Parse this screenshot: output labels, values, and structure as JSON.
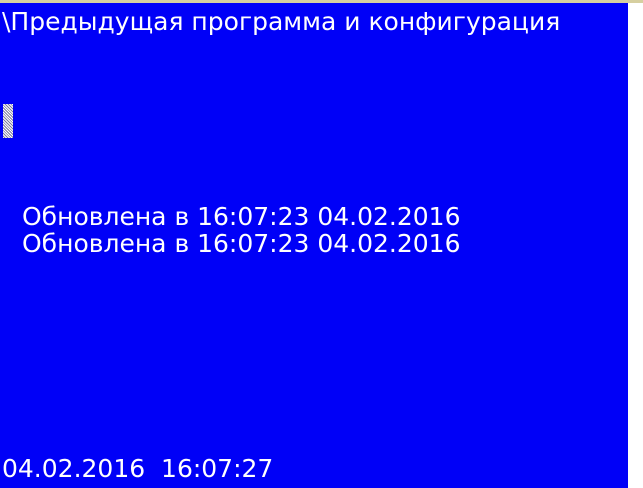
{
  "screen": {
    "title": "\\Предыдущая программа и конфигурация",
    "background_color": "#0000f7",
    "text_color": "#ffffff",
    "status_lines": [
      "Обновлена в 16:07:23 04.02.2016",
      "Обновлена в 16:07:23 04.02.2016"
    ],
    "footer_date": "04.02.2016",
    "footer_time": "16:07:27"
  }
}
